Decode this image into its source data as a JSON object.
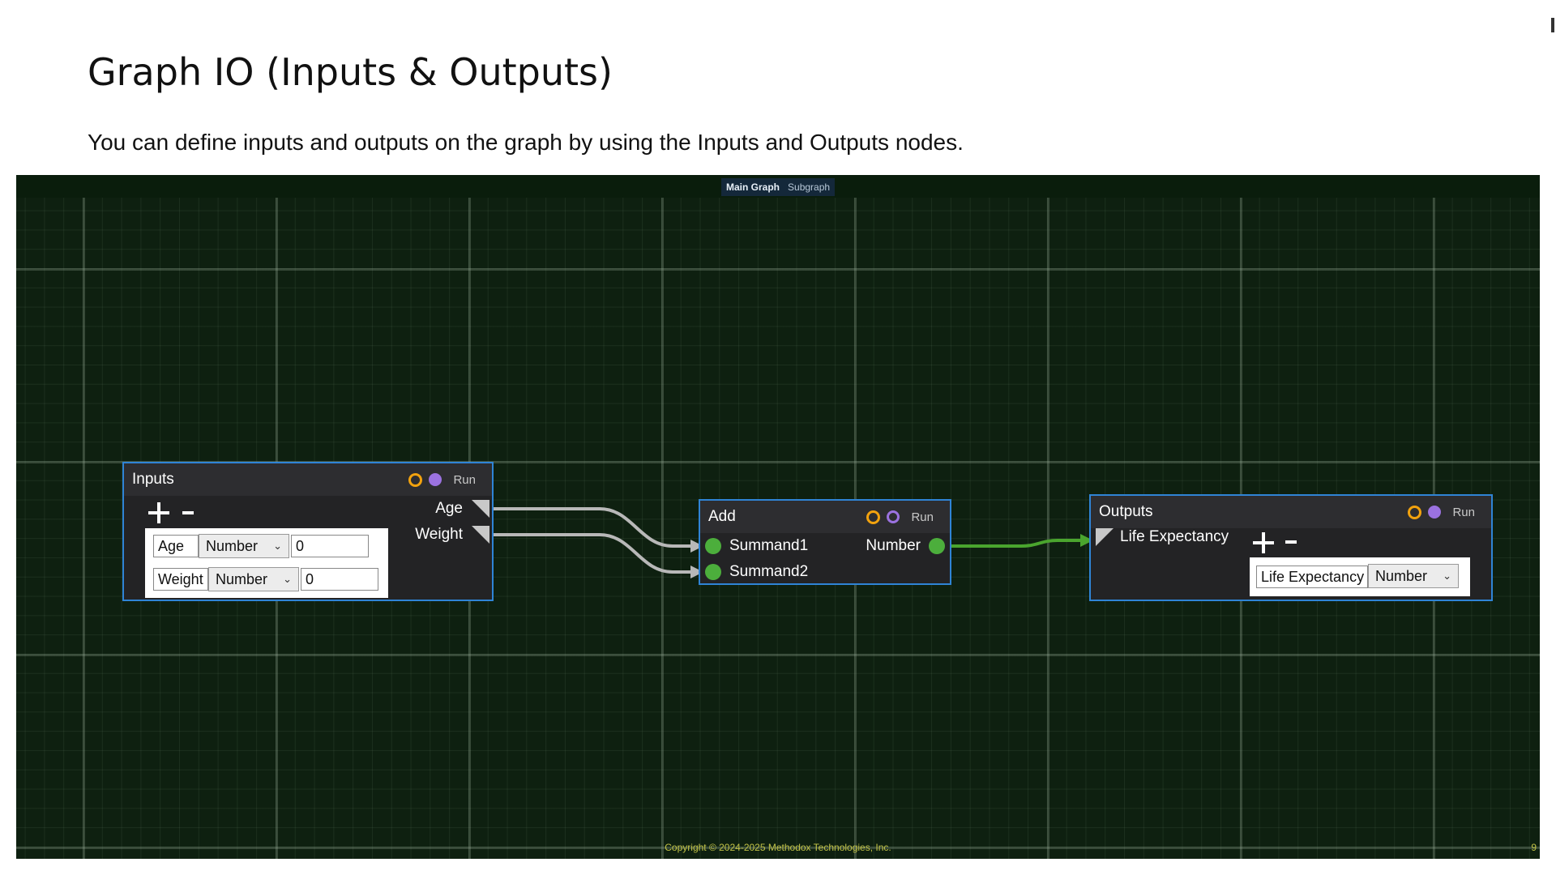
{
  "slide": {
    "title": "Graph IO (Inputs & Outputs)",
    "description": "You can define inputs and outputs on the graph by using the Inputs and Outputs nodes."
  },
  "graph_tabs": [
    "Main Graph",
    "Subgraph"
  ],
  "active_tab": "Main Graph",
  "nodes": {
    "inputs": {
      "title": "Inputs",
      "run_label": "Run",
      "pins": [
        "Age",
        "Weight"
      ],
      "rows": [
        {
          "name": "Age",
          "type": "Number",
          "value": "0"
        },
        {
          "name": "Weight",
          "type": "Number",
          "value": "0"
        }
      ]
    },
    "add": {
      "title": "Add",
      "run_label": "Run",
      "inputs": [
        "Summand1",
        "Summand2"
      ],
      "output": "Number"
    },
    "outputs": {
      "title": "Outputs",
      "run_label": "Run",
      "pins": [
        "Life Expectancy"
      ],
      "rows": [
        {
          "name": "Life Expectancy",
          "type": "Number"
        }
      ]
    }
  },
  "colors": {
    "canvas": "#0e2010",
    "node_border": "#2f84d6",
    "exec_orange": "#f2a20e",
    "exec_purple": "#9b72e0",
    "number_pin": "#4cae3c",
    "wire_gray": "#b8b8b8",
    "wire_green": "#4aa52e"
  },
  "footer": {
    "copyright": "Copyright © 2024-2025 Methodox Technologies, Inc.",
    "page_number": "9"
  }
}
